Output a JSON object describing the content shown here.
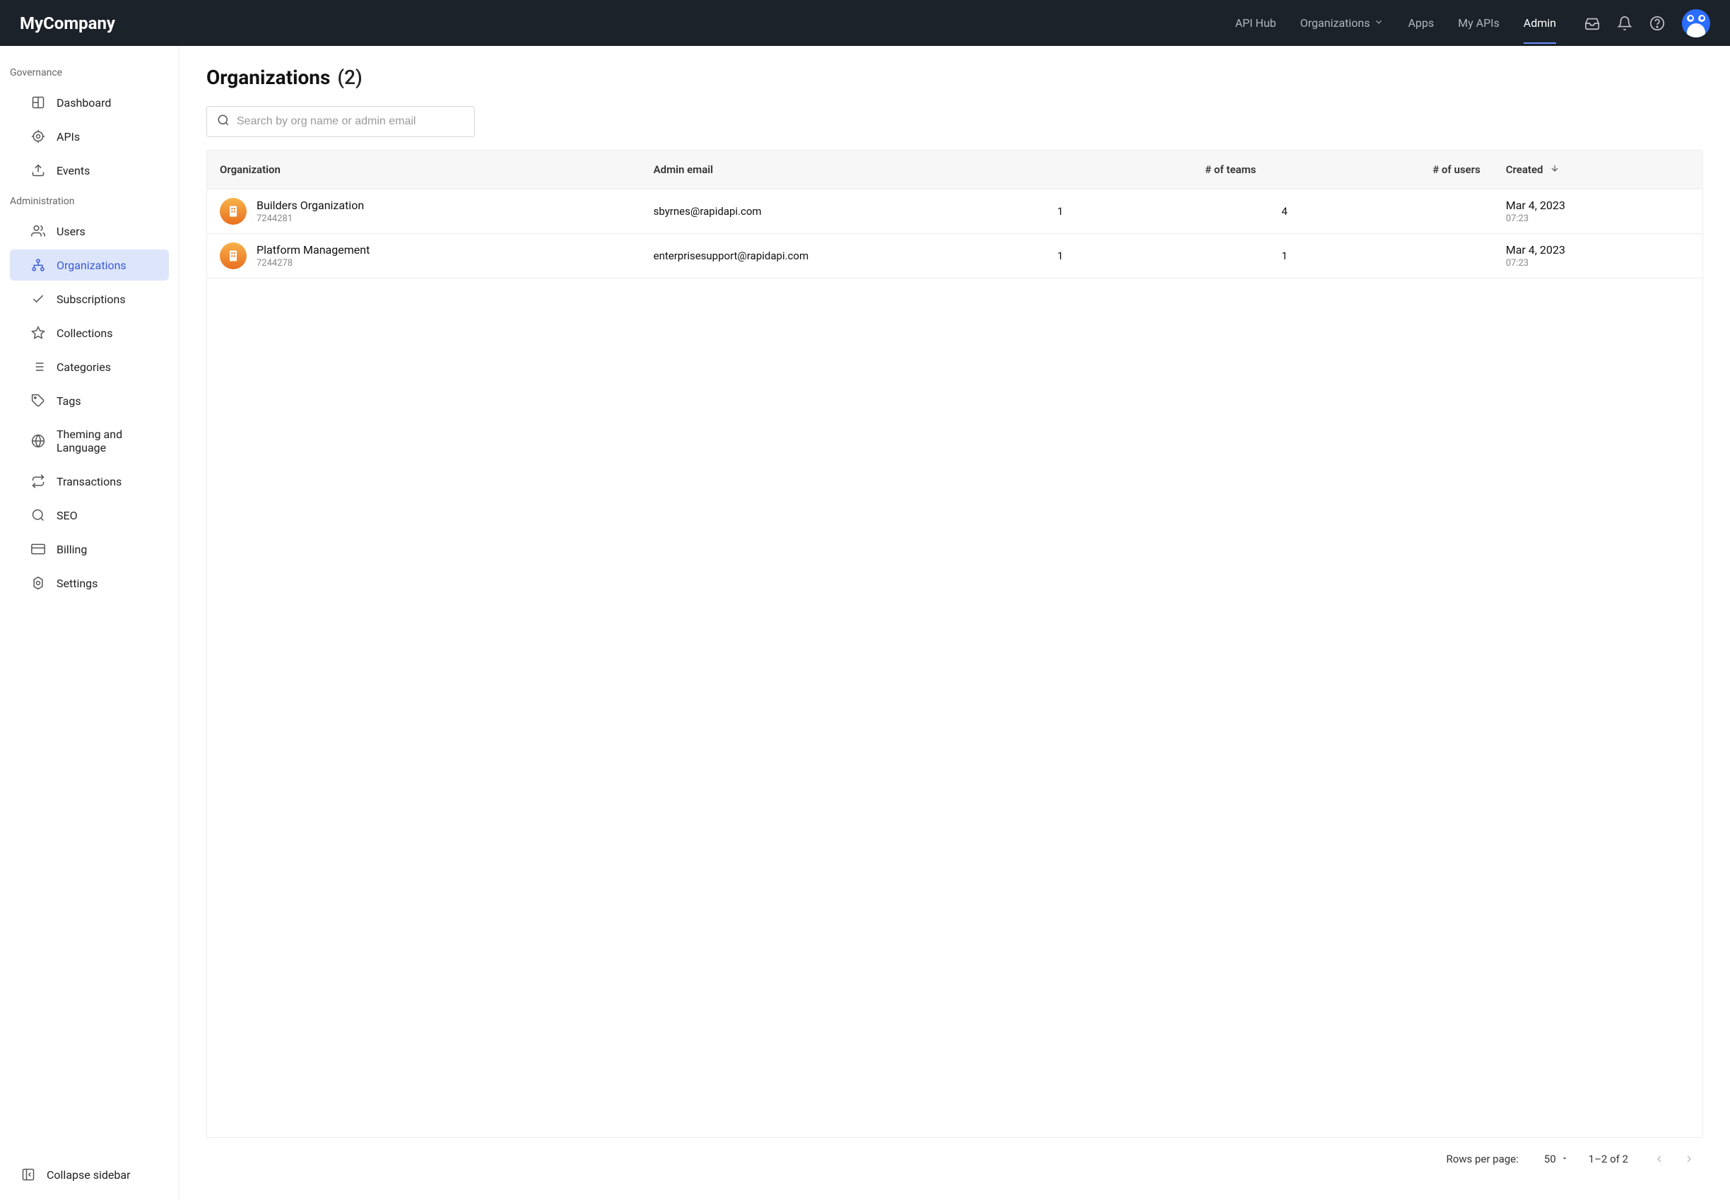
{
  "header": {
    "brand": "MyCompany",
    "nav": [
      {
        "label": "API Hub",
        "active": false,
        "hasDropdown": false
      },
      {
        "label": "Organizations",
        "active": false,
        "hasDropdown": true
      },
      {
        "label": "Apps",
        "active": false,
        "hasDropdown": false
      },
      {
        "label": "My APIs",
        "active": false,
        "hasDropdown": false
      },
      {
        "label": "Admin",
        "active": true,
        "hasDropdown": false
      }
    ]
  },
  "sidebar": {
    "sections": {
      "governance": {
        "label": "Governance",
        "items": [
          {
            "label": "Dashboard"
          },
          {
            "label": "APIs"
          },
          {
            "label": "Events"
          }
        ]
      },
      "administration": {
        "label": "Administration",
        "items": [
          {
            "label": "Users"
          },
          {
            "label": "Organizations",
            "active": true
          },
          {
            "label": "Subscriptions"
          },
          {
            "label": "Collections"
          },
          {
            "label": "Categories"
          },
          {
            "label": "Tags"
          },
          {
            "label": "Theming and Language"
          },
          {
            "label": "Transactions"
          },
          {
            "label": "SEO"
          },
          {
            "label": "Billing"
          },
          {
            "label": "Settings"
          }
        ]
      }
    },
    "collapse_label": "Collapse sidebar"
  },
  "page": {
    "title": "Organizations",
    "count": "(2)",
    "search_placeholder": "Search by org name or admin email"
  },
  "table": {
    "columns": {
      "organization": "Organization",
      "admin_email": "Admin email",
      "teams": "# of teams",
      "users": "# of users",
      "created": "Created"
    },
    "rows": [
      {
        "name": "Builders Organization",
        "id": "7244281",
        "admin_email": "sbyrnes@rapidapi.com",
        "teams": "1",
        "users": "4",
        "created_date": "Mar 4, 2023",
        "created_time": "07:23"
      },
      {
        "name": "Platform Management",
        "id": "7244278",
        "admin_email": "enterprisesupport@rapidapi.com",
        "teams": "1",
        "users": "1",
        "created_date": "Mar 4, 2023",
        "created_time": "07:23"
      }
    ]
  },
  "pagination": {
    "rows_label": "Rows per page:",
    "rows_value": "50",
    "range_text": "1–2 of 2"
  }
}
